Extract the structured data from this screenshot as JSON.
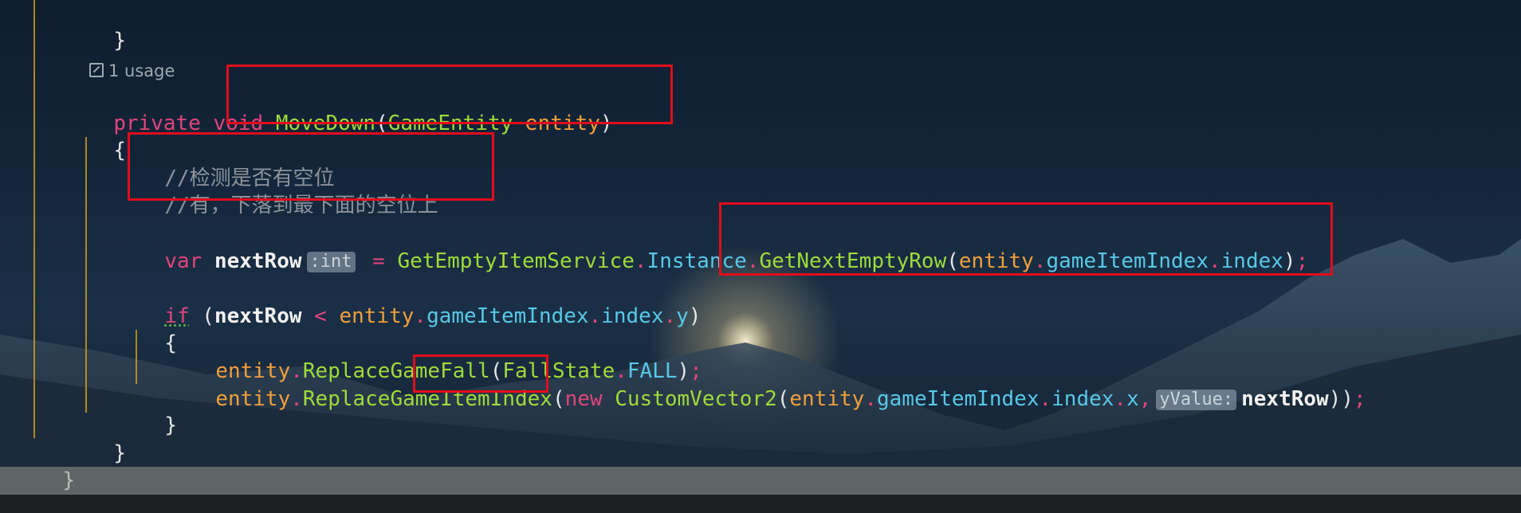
{
  "code": {
    "closing_brace_top": "}",
    "usage_label": "1 usage",
    "sig_private": "private",
    "sig_void": "void",
    "sig_method": "MoveDown",
    "sig_paren_open": "(",
    "sig_param_type": "GameEntity",
    "sig_param_name": "entity",
    "sig_paren_close": ")",
    "open_brace": "{",
    "comment1": "//检测是否有空位",
    "comment2": "//有，下落到最下面的空位上",
    "var_kw": "var",
    "var_name": "nextRow",
    "var_hint": ":int",
    "assign": "=",
    "service": "GetEmptyItemService",
    "instance": "Instance",
    "get_next": "GetNextEmptyRow",
    "entity": "entity",
    "game_item_index": "gameItemIndex",
    "index": "index",
    "if_kw": "if",
    "lt": "<",
    "y": "y",
    "x": "x",
    "replace_fall": "ReplaceGameFall",
    "fall_state": "FallState",
    "fall": "FALL",
    "replace_index": "ReplaceGameItemIndex",
    "new_kw": "new",
    "vector": "CustomVector2",
    "yvalue_hint": "yValue:",
    "next_row_arg": "nextRow",
    "close_brace": "}"
  }
}
